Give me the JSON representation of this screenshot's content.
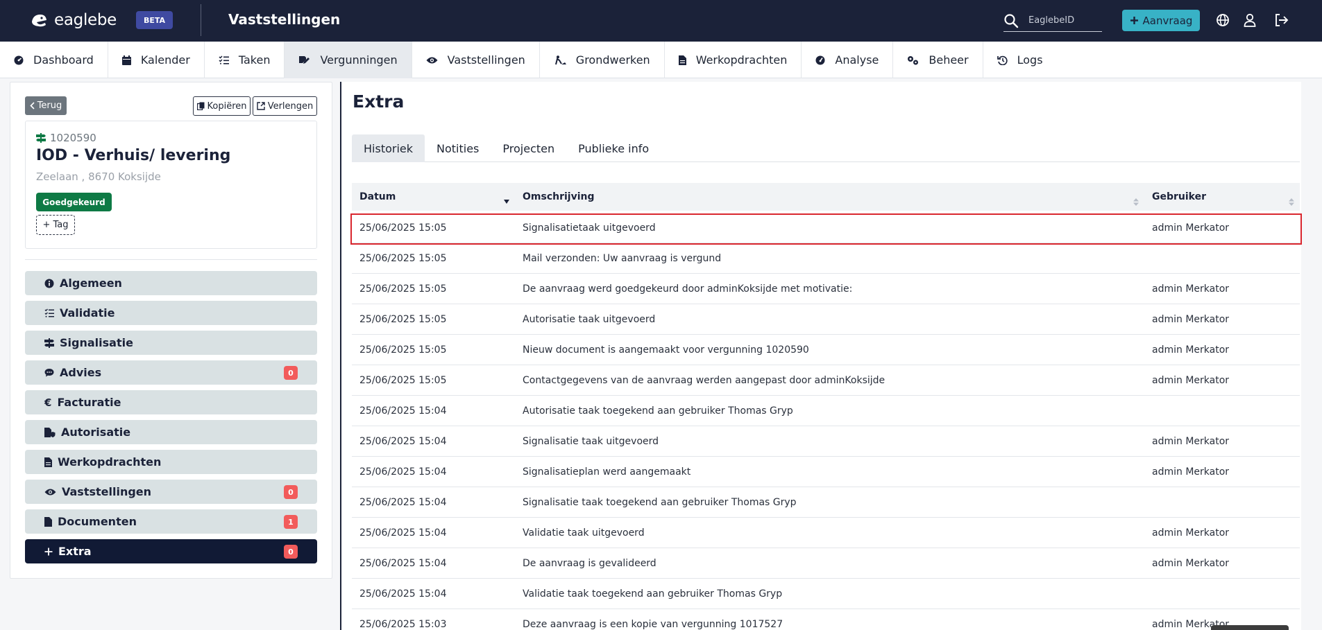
{
  "topbar": {
    "logo_text": "eaglebe",
    "beta_label": "BETA",
    "title": "Vaststellingen",
    "search_placeholder": "EaglebeID",
    "aanvraag_label": "Aanvraag",
    "icons": [
      "search-icon",
      "plus-icon",
      "globe-icon",
      "user-icon",
      "logout-icon"
    ]
  },
  "nav": {
    "items": [
      {
        "label": "Dashboard",
        "icon": "dashboard-icon"
      },
      {
        "label": "Kalender",
        "icon": "calendar-icon"
      },
      {
        "label": "Taken",
        "icon": "tasks-icon"
      },
      {
        "label": "Vergunningen",
        "icon": "edit-document-icon"
      },
      {
        "label": "Vaststellingen",
        "icon": "eye-icon"
      },
      {
        "label": "Grondwerken",
        "icon": "digging-icon"
      },
      {
        "label": "Werkopdrachten",
        "icon": "document-icon"
      },
      {
        "label": "Analyse",
        "icon": "gauge-icon"
      },
      {
        "label": "Beheer",
        "icon": "cogs-icon"
      },
      {
        "label": "Logs",
        "icon": "history-icon"
      }
    ],
    "active": "Vergunningen"
  },
  "permit": {
    "back_label": "Terug",
    "copy_label": "Kopiëren",
    "extend_label": "Verlengen",
    "number": "1020590",
    "title": "IOD - Verhuis/ levering",
    "address": "Zeelaan , 8670 Koksijde",
    "status": "Goedgekeurd",
    "tag_label": "+ Tag"
  },
  "menu": {
    "items": [
      {
        "label": "Algemeen",
        "icon": "info-icon",
        "count": null
      },
      {
        "label": "Validatie",
        "icon": "checklist-icon",
        "count": null
      },
      {
        "label": "Signalisatie",
        "icon": "signpost-icon",
        "count": null
      },
      {
        "label": "Advies",
        "icon": "comment-icon",
        "count": "0"
      },
      {
        "label": "Facturatie",
        "icon": "euro-icon",
        "count": null
      },
      {
        "label": "Autorisatie",
        "icon": "file-shield-icon",
        "count": null
      },
      {
        "label": "Werkopdrachten",
        "icon": "document-icon",
        "count": null
      },
      {
        "label": "Vaststellingen",
        "icon": "eye-icon",
        "count": "0"
      },
      {
        "label": "Documenten",
        "icon": "file-icon",
        "count": "1"
      },
      {
        "label": "Extra",
        "icon": "plus-icon",
        "count": "0"
      }
    ],
    "active": "Extra"
  },
  "extra": {
    "title": "Extra",
    "tabs": [
      "Historiek",
      "Notities",
      "Projecten",
      "Publieke info"
    ],
    "active_tab": "Historiek",
    "columns": [
      "Datum",
      "Omschrijving",
      "Gebruiker"
    ],
    "rows": [
      {
        "date": "25/06/2025 15:05",
        "desc": "Signalisatietaak uitgevoerd",
        "user": "admin Merkator"
      },
      {
        "date": "25/06/2025 15:05",
        "desc": "Mail verzonden: Uw aanvraag is vergund",
        "user": ""
      },
      {
        "date": "25/06/2025 15:05",
        "desc": "De aanvraag werd goedgekeurd door adminKoksijde met motivatie:",
        "user": "admin Merkator"
      },
      {
        "date": "25/06/2025 15:05",
        "desc": "Autorisatie taak uitgevoerd",
        "user": "admin Merkator"
      },
      {
        "date": "25/06/2025 15:05",
        "desc": "Nieuw document is aangemaakt voor vergunning 1020590",
        "user": "admin Merkator"
      },
      {
        "date": "25/06/2025 15:05",
        "desc": "Contactgegevens van de aanvraag werden aangepast door adminKoksijde",
        "user": "admin Merkator"
      },
      {
        "date": "25/06/2025 15:04",
        "desc": "Autorisatie taak toegekend aan gebruiker Thomas Gryp",
        "user": ""
      },
      {
        "date": "25/06/2025 15:04",
        "desc": "Signalisatie taak uitgevoerd",
        "user": "admin Merkator"
      },
      {
        "date": "25/06/2025 15:04",
        "desc": "Signalisatieplan werd aangemaakt",
        "user": "admin Merkator"
      },
      {
        "date": "25/06/2025 15:04",
        "desc": "Signalisatie taak toegekend aan gebruiker Thomas Gryp",
        "user": ""
      },
      {
        "date": "25/06/2025 15:04",
        "desc": "Validatie taak uitgevoerd",
        "user": "admin Merkator"
      },
      {
        "date": "25/06/2025 15:04",
        "desc": "De aanvraag is gevalideerd",
        "user": "admin Merkator"
      },
      {
        "date": "25/06/2025 15:04",
        "desc": "Validatie taak toegekend aan gebruiker Thomas Gryp",
        "user": ""
      },
      {
        "date": "25/06/2025 15:03",
        "desc": "Deze aanvraag is een kopie van vergunning 1017527",
        "user": "admin Merkator"
      }
    ]
  },
  "colors": {
    "topbar_bg": "#1b2239",
    "accent_cyan": "#38b2c6",
    "status_green": "#0e7a45",
    "count_red": "#f25b5b",
    "menu_bg": "#d9e1e3",
    "menu_active_bg": "#111a35",
    "highlight_red": "#d9262e"
  }
}
